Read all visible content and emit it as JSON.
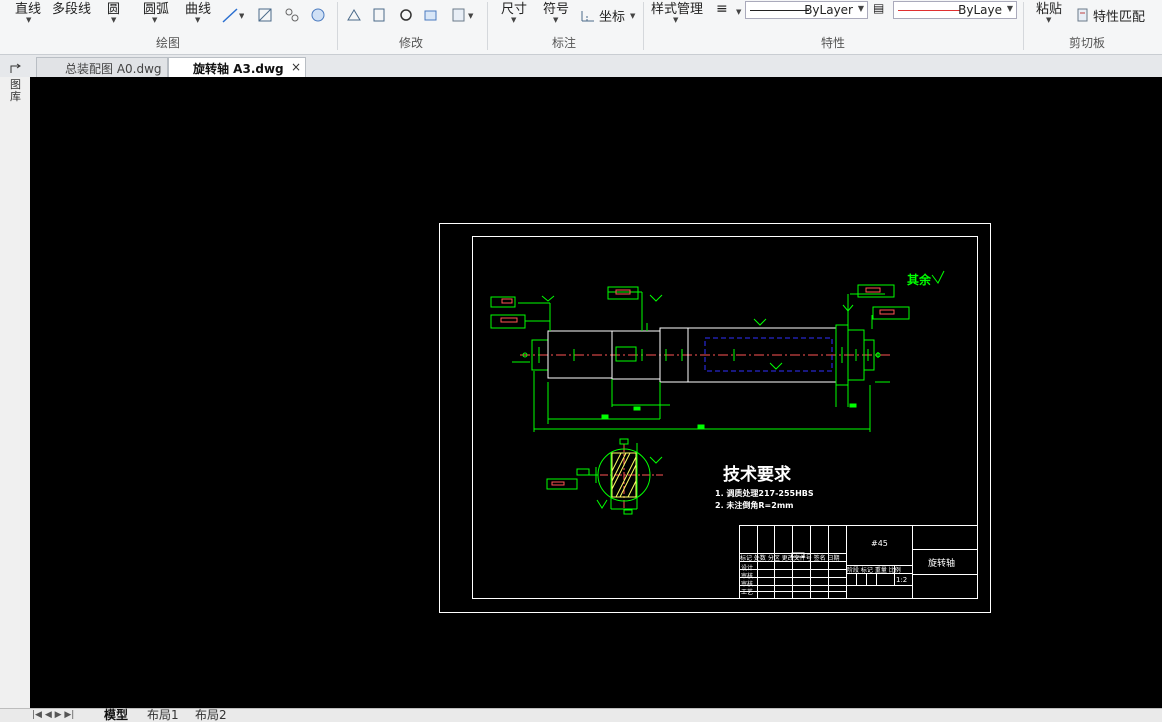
{
  "ribbon": {
    "draw": {
      "line": "直线",
      "polyline": "多段线",
      "circle": "圆",
      "arc": "圆弧",
      "curve": "曲线",
      "group": "绘图"
    },
    "modify": {
      "group": "修改"
    },
    "annotate": {
      "dimension": "尺寸",
      "symbol": "符号",
      "coordinate": "坐标",
      "group": "标注"
    },
    "properties": {
      "style_manager": "样式管理",
      "linetype_value": "ByLayer",
      "color_value": "ByLaye",
      "group": "特性"
    },
    "clipboard": {
      "paste": "粘贴",
      "match_properties": "特性匹配",
      "group": "剪切板"
    }
  },
  "tabs": [
    {
      "label": "总装配图 A0.dwg",
      "active": false
    },
    {
      "label": "旋转轴 A3.dwg",
      "active": true,
      "close": "×"
    }
  ],
  "left_strip": {
    "label": "图库"
  },
  "drawing": {
    "tech_title": "技术要求",
    "tech_req_1": "1. 调质处理217-255HBS",
    "tech_req_2": "2. 未注倒角R=2mm",
    "roughness_note": "其余",
    "title_block": {
      "material": "#45",
      "part_name": "旋转轴",
      "scale": "1:2",
      "row_headers": "标记 处数  分区   更改文件号  签名  日期",
      "stage_headers": "阶段  标记  重量  比例",
      "roles": [
        "设计",
        "审核",
        "审核",
        "工艺"
      ]
    }
  },
  "layout_tabs": {
    "nav": "|◀ ◀ ▶ ▶|",
    "model": "模型",
    "layout1": "布局1",
    "layout2": "布局2"
  },
  "colors": {
    "canvas": "#000000",
    "geometry": "#00ff00",
    "hidden": "#0000ff",
    "frame": "#ffffff",
    "accent_red": "#e03030"
  }
}
